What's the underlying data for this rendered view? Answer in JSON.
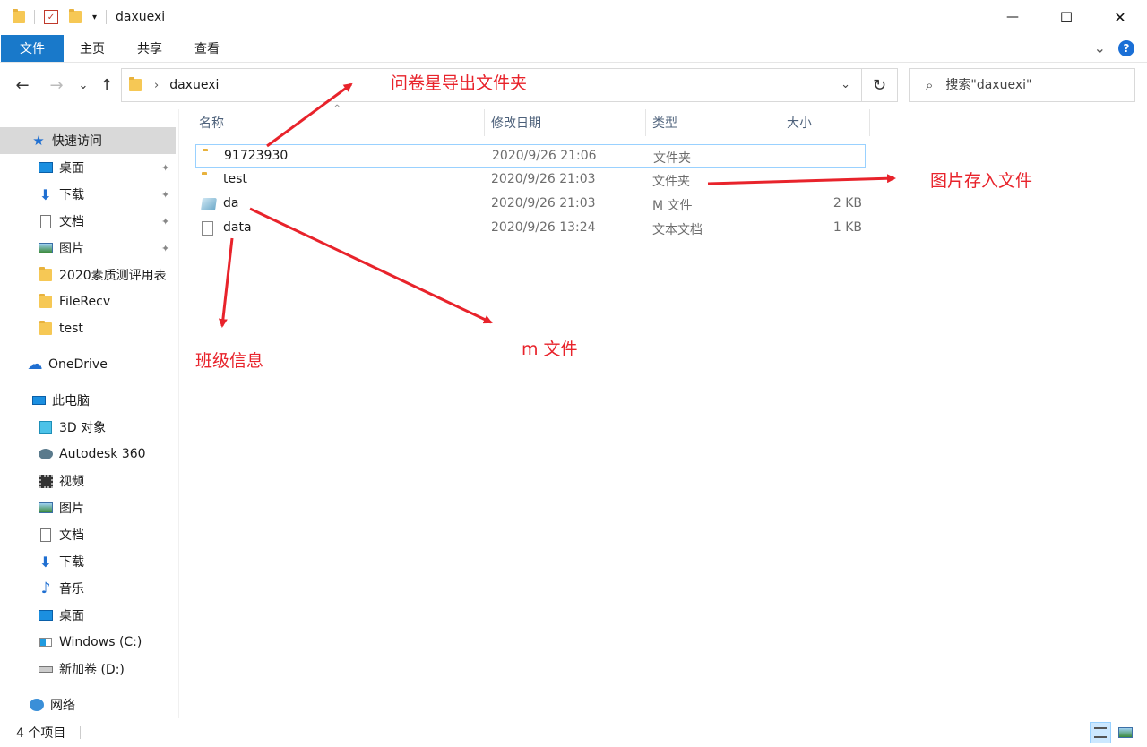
{
  "window": {
    "title": "daxuexi",
    "minimize_glyph": "—",
    "maximize_glyph": "☐",
    "close_glyph": "✕"
  },
  "ribbon": {
    "tabs": [
      {
        "label": "文件",
        "active": true
      },
      {
        "label": "主页"
      },
      {
        "label": "共享"
      },
      {
        "label": "查看"
      }
    ],
    "collapse_glyph": "⌄",
    "help_glyph": "?"
  },
  "nav": {
    "back_glyph": "←",
    "forward_glyph": "→",
    "recent_glyph": "⌄",
    "up_glyph": "↑",
    "breadcrumb": [
      "daxuexi"
    ],
    "crumb_separator": "›",
    "dropdown_glyph": "⌄",
    "refresh_glyph": "↻",
    "search_placeholder": "搜索\"daxuexi\"",
    "search_icon_glyph": "⌕"
  },
  "sidebar": {
    "items": [
      {
        "label": "快速访问",
        "icon": "star-icon",
        "selected": true
      },
      {
        "label": "桌面",
        "icon": "desktop-icon",
        "pinned": true
      },
      {
        "label": "下载",
        "icon": "download-icon",
        "pinned": true
      },
      {
        "label": "文档",
        "icon": "document-icon",
        "pinned": true
      },
      {
        "label": "图片",
        "icon": "pictures-icon",
        "pinned": true
      },
      {
        "label": "2020素质测评用表",
        "icon": "folder-icon"
      },
      {
        "label": "FileRecv",
        "icon": "folder-icon"
      },
      {
        "label": "test",
        "icon": "folder-icon"
      },
      {
        "label": "OneDrive",
        "icon": "cloud-icon"
      },
      {
        "label": "此电脑",
        "icon": "computer-icon"
      },
      {
        "label": "3D 对象",
        "icon": "cube-icon"
      },
      {
        "label": "Autodesk 360",
        "icon": "autodesk-icon"
      },
      {
        "label": "视频",
        "icon": "video-icon"
      },
      {
        "label": "图片",
        "icon": "pictures-icon"
      },
      {
        "label": "文档",
        "icon": "document-icon"
      },
      {
        "label": "下载",
        "icon": "download-icon"
      },
      {
        "label": "音乐",
        "icon": "music-icon"
      },
      {
        "label": "桌面",
        "icon": "desktop-icon"
      },
      {
        "label": "Windows (C:)",
        "icon": "windows-drive-icon"
      },
      {
        "label": "新加卷 (D:)",
        "icon": "drive-icon"
      },
      {
        "label": "网络",
        "icon": "network-icon"
      }
    ],
    "pin_glyph": "📌",
    "star_glyph": "★",
    "cloud_glyph": "☁",
    "music_glyph": "♪"
  },
  "columns": [
    "名称",
    "修改日期",
    "类型",
    "大小"
  ],
  "sort_glyph": "^",
  "files": [
    {
      "name": "91723930",
      "date": "2020/9/26 21:06",
      "type": "文件夹",
      "size": "",
      "icon": "folder-icon"
    },
    {
      "name": "test",
      "date": "2020/9/26 21:03",
      "type": "文件夹",
      "size": "",
      "icon": "folder-icon"
    },
    {
      "name": "da",
      "date": "2020/9/26 21:03",
      "type": "M 文件",
      "size": "2 KB",
      "icon": "m-file-icon"
    },
    {
      "name": "data",
      "date": "2020/9/26 13:24",
      "type": "文本文档",
      "size": "1 KB",
      "icon": "text-file-icon"
    }
  ],
  "annotations": {
    "wenjuanxing": "问卷星导出文件夹",
    "picture_store": "图片存入文件",
    "class_info": "班级信息",
    "m_file": "m 文件",
    "color": "#e8232b"
  },
  "status": {
    "count": "4 个项目"
  }
}
